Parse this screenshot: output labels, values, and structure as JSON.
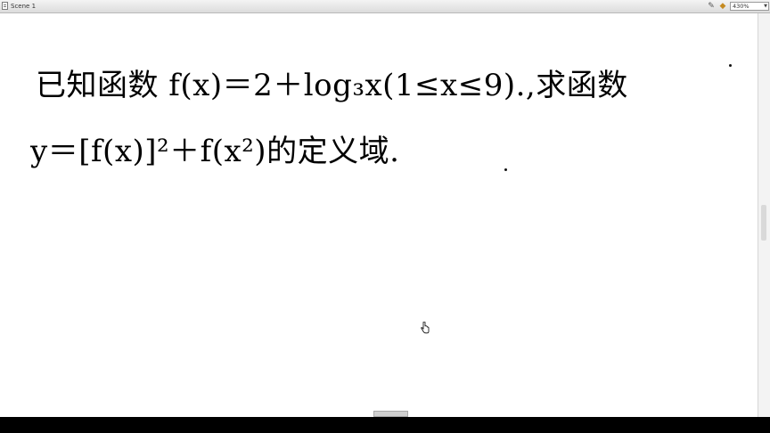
{
  "window": {
    "tab_title": "Scene 1",
    "zoom": "430%",
    "icons": [
      "document-icon",
      "edit-scene-icon",
      "edit-symbol-icon",
      "chevron-down-icon",
      "pointer-cursor-icon"
    ]
  },
  "problem": {
    "line1": [
      "已知函数 f(x)＝2＋log₃x(1≤x≤9)",
      ".",
      ",求函数"
    ],
    "line2": [
      "y＝[f(x)]²＋f(x²)的定义域",
      "."
    ]
  }
}
